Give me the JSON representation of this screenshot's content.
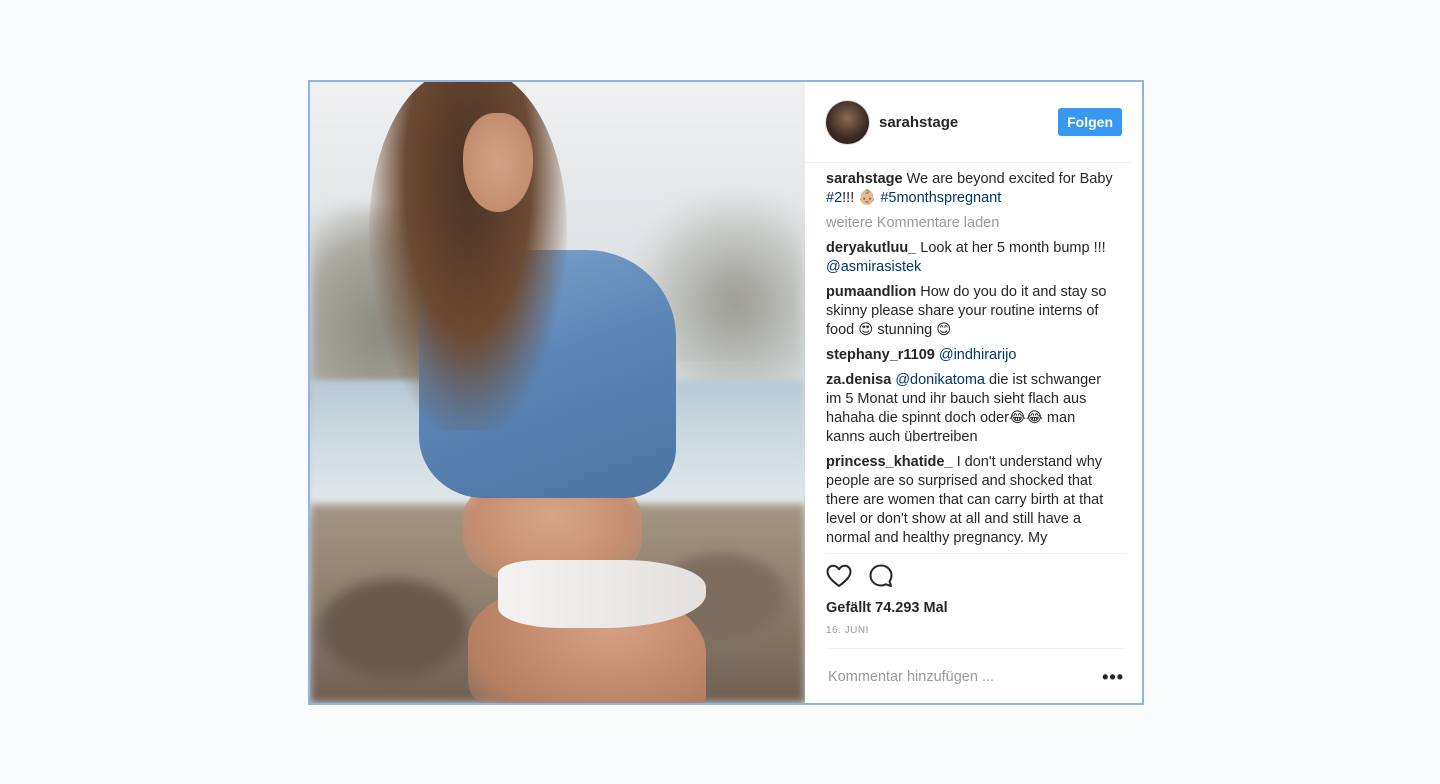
{
  "post": {
    "username": "sarahstage",
    "follow_label": "Folgen",
    "caption": {
      "user": "sarahstage",
      "text_a": " We are beyond excited for Baby ",
      "tag_a": "#2",
      "text_b": "!!! 👶🏼 ",
      "tag_b": "#5monthspregnant"
    },
    "load_more": "weitere Kommentare laden",
    "comments": [
      {
        "user": "deryakutluu_",
        "text_a": " Look at her 5 month bump !!! ",
        "tag_a": "@asmirasistek",
        "text_b": ""
      },
      {
        "user": "pumaandlion",
        "text_a": " How do you do it and stay so skinny please share your routine interns of food 😍  stunning 😊",
        "tag_a": "",
        "text_b": ""
      },
      {
        "user": "stephany_r1109",
        "text_a": " ",
        "tag_a": "@indhirarijo",
        "text_b": ""
      },
      {
        "user": "za.denisa",
        "text_a": " ",
        "tag_a": "@donikatoma",
        "text_b": " die ist schwanger im 5 Monat und ihr bauch sieht flach aus hahaha die spinnt doch oder😂😂 man kanns auch übertreiben"
      },
      {
        "user": "princess_khatide_",
        "text_a": " I don't understand why people are so surprised and shocked that there are women that can carry birth at that level or don't show at all and still have a normal and healthy pregnancy. My",
        "tag_a": "",
        "text_b": ""
      }
    ],
    "likes": "Gefällt 74.293 Mal",
    "date": "16. JUNI",
    "comment_placeholder": "Kommentar hinzufügen ...",
    "more_label": "•••",
    "icons": [
      "heart-icon",
      "comment-icon",
      "more-icon"
    ]
  },
  "colors": {
    "follow_button": "#3897f0",
    "tag": "#003569",
    "frame_border": "#8fb3e3"
  }
}
